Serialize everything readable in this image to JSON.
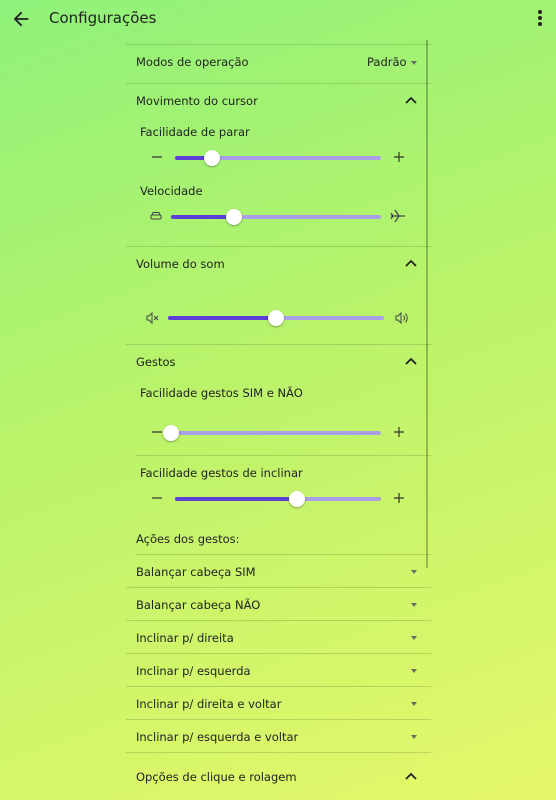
{
  "header": {
    "title": "Configurações"
  },
  "operation_modes": {
    "label": "Modos de operação",
    "value": "Padrão"
  },
  "cursor": {
    "label": "Movimento do cursor",
    "stop_ease": {
      "label": "Facilidade de parar",
      "value": 0.18
    },
    "speed": {
      "label": "Velocidade",
      "value": 0.3
    }
  },
  "sound": {
    "label": "Volume do som",
    "value": 0.5
  },
  "gestures": {
    "label": "Gestos",
    "yes_no": {
      "label": "Facilidade gestos SIM e NÃO",
      "value": 0.0
    },
    "tilt": {
      "label": "Facilidade gestos de inclinar",
      "value": 0.59
    },
    "actions_label": "Ações dos gestos:",
    "actions": [
      "Balançar cabeça SIM",
      "Balançar cabeça NÃO",
      "Inclinar p/ direita",
      "Inclinar p/ esquerda",
      "Inclinar p/ direita e voltar",
      "Inclinar p/ esquerda e voltar"
    ]
  },
  "click_scroll": {
    "label": "Opções de clique e rolagem"
  },
  "icons": {
    "back": "arrow-left-icon",
    "menu": "more-vert-icon",
    "chevron": "chevron-up-icon",
    "minus": "minus-icon",
    "plus": "plus-icon",
    "slow": "car-icon",
    "fast": "airplane-icon",
    "mute": "volume-mute-icon",
    "volume": "volume-up-icon",
    "caret": "caret-down-icon"
  },
  "colors": {
    "accent": "#5b3fd6",
    "track": "#a99ee8"
  }
}
